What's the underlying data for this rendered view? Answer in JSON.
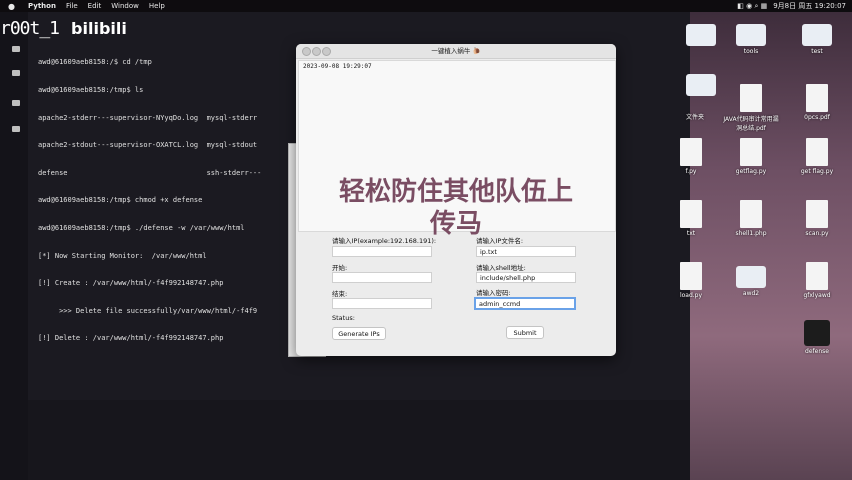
{
  "menubar": {
    "app": "Python",
    "items": [
      "File",
      "Edit",
      "Window",
      "Help"
    ],
    "datetime": "9月8日 周五 19:20:07"
  },
  "watermark": {
    "user": "r00t_1",
    "brand": "bilibili"
  },
  "terminal": {
    "lines": [
      "awd@61609aeb8158:/$ cd /tmp",
      "awd@61609aeb8158:/tmp$ ls",
      "apache2-stderr---supervisor-NYyqDo.log  mysql-stderr",
      "apache2-stdout---supervisor-OXATCL.log  mysql-stdout",
      "defense                                 ssh-stderr---",
      "awd@61609aeb8158:/tmp$ chmod +x defense",
      "awd@61609aeb8158:/tmp$ ./defense -w /var/www/html",
      "[*] Now Starting Monitor:  /var/www/html",
      "[!] Create : /var/www/html/-f4f992148747.php",
      "     >>> Delete file successfully/var/www/html/-f4f9",
      "[!] Delete : /var/www/html/-f4f992148747.php"
    ]
  },
  "desktop_icons": [
    {
      "label": "",
      "kind": "folder"
    },
    {
      "label": "",
      "kind": "folder"
    },
    {
      "label": "tools",
      "kind": "folder"
    },
    {
      "label": "test",
      "kind": "folder"
    },
    {
      "label": "文件夹",
      "kind": "folder"
    },
    {
      "label": "JAVA代码审计常用漏洞总结.pdf",
      "kind": "doc"
    },
    {
      "label": "0pcs.pdf",
      "kind": "doc"
    },
    {
      "label": "f.py",
      "kind": "doc"
    },
    {
      "label": "getflag.py",
      "kind": "doc"
    },
    {
      "label": "get flag.py",
      "kind": "doc"
    },
    {
      "label": "txt",
      "kind": "doc"
    },
    {
      "label": "shell1.php",
      "kind": "doc"
    },
    {
      "label": "scan.py",
      "kind": "doc"
    },
    {
      "label": "load.py",
      "kind": "doc"
    },
    {
      "label": "awd2",
      "kind": "folder"
    },
    {
      "label": "gfxlyawd",
      "kind": "doc"
    },
    {
      "label": "defense",
      "kind": "exe"
    }
  ],
  "app": {
    "title": "一键植入蜗牛 🐌",
    "log_line": "2023-09-08 19:29:07",
    "overlay_text_line1": "轻松防住其他队伍上",
    "overlay_text_line2": "传马",
    "labels": {
      "ip_example": "请输入IP(example:192.168.191):",
      "ip_file": "请输入IP文件名:",
      "start": "开始:",
      "shell_path": "请输入shell地址:",
      "end": "结束:",
      "password": "请输入密码:",
      "status": "Status:"
    },
    "values": {
      "ip_example": "",
      "ip_file": "ip.txt",
      "start": "",
      "shell_path": "include/shell.php",
      "end": "",
      "password": "admin_ccmd"
    },
    "buttons": {
      "generate": "Generate IPs",
      "submit": "Submit"
    }
  }
}
